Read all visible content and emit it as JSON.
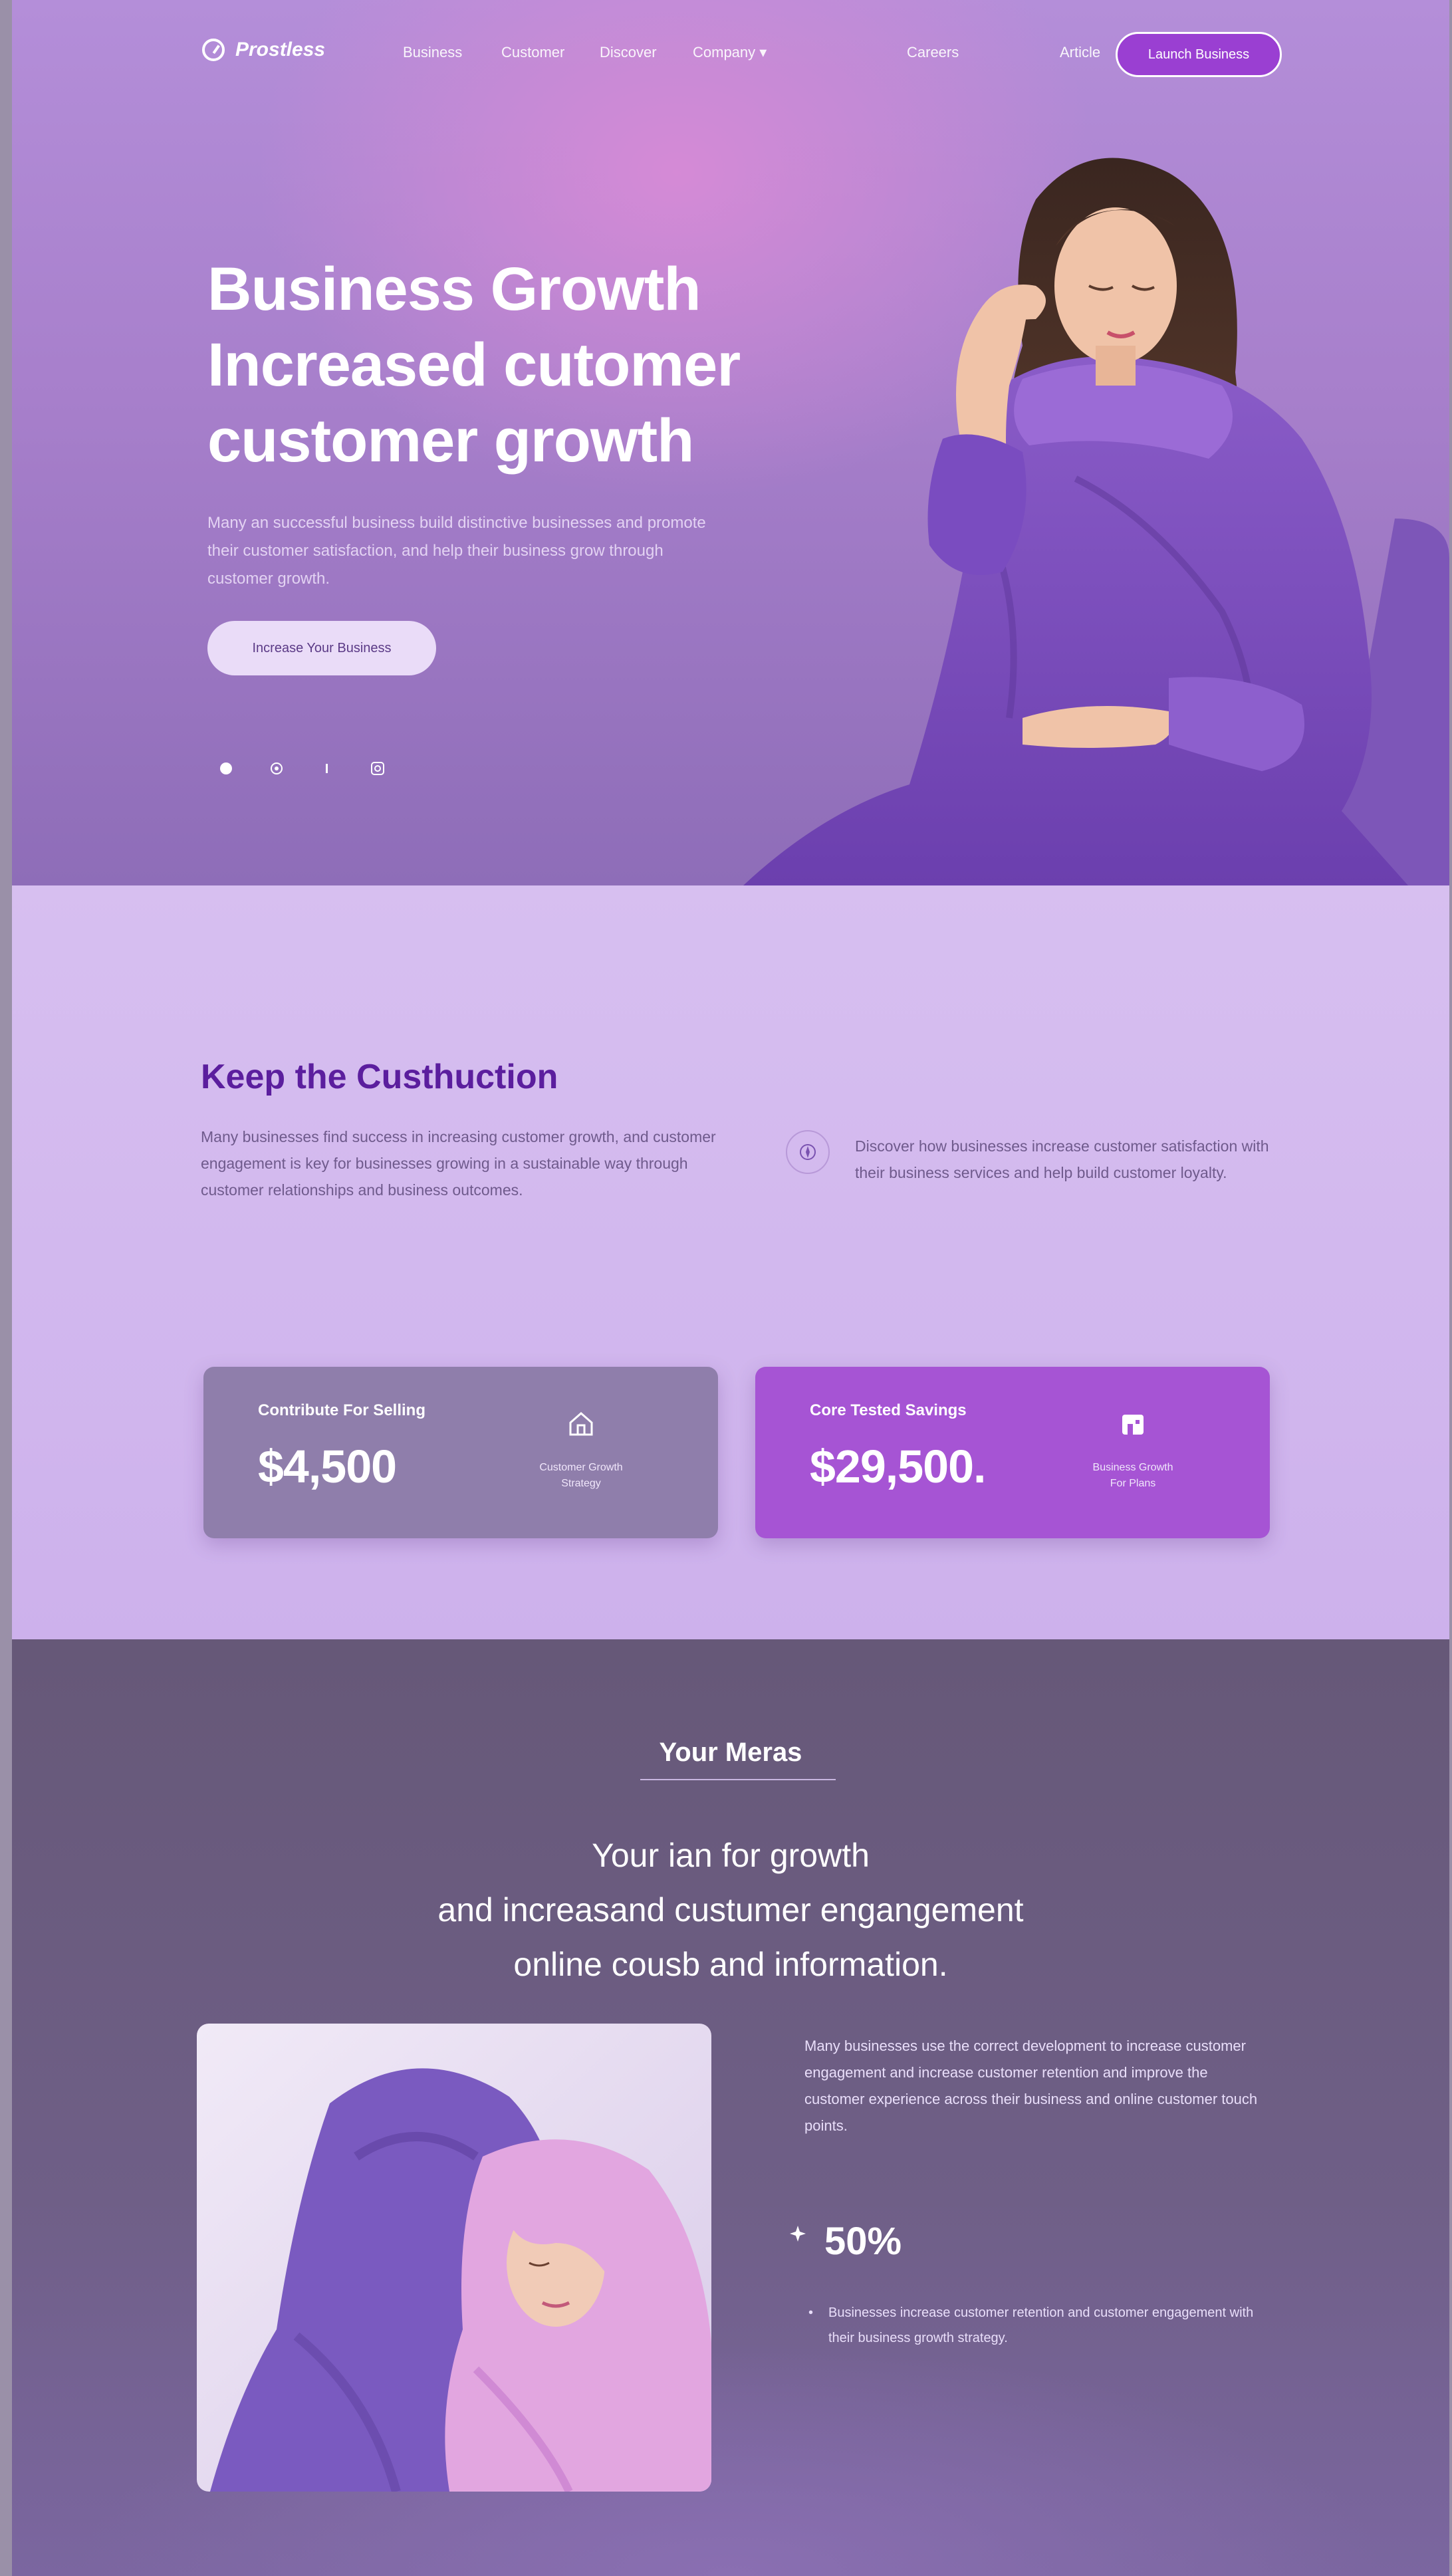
{
  "nav": {
    "brand": "Prostless",
    "links": [
      "Business",
      "Customer",
      "Discover",
      "Company ▾"
    ],
    "right_links": [
      "Careers",
      "Article"
    ],
    "cta": "Launch Business"
  },
  "hero": {
    "title_lines": [
      "Business Growth",
      "Increased cutomer",
      "customer growth"
    ],
    "description": "Many an successful business build distinctive businesses and promote their customer satisfaction, and help their business grow through customer growth.",
    "button": "Increase Your Business"
  },
  "section2": {
    "title": "Keep the Custhuction",
    "description": "Many businesses find success in increasing customer growth, and customer engagement is key for businesses growing in a sustainable way through customer relationships and business outcomes.",
    "info_text": "Discover how businesses increase customer satisfaction with their business services and help build customer loyalty.",
    "cards": [
      {
        "label": "Contribute For Selling",
        "value": "$4,500",
        "sub": "Customer Growth Strategy"
      },
      {
        "label": "Core Tested Savings",
        "value": "$29,500.",
        "sub": "Business Growth For Plans"
      }
    ]
  },
  "section3": {
    "kicker": "Your Meras",
    "heading_lines": [
      "Your ian for growth",
      "and increasand custumer engangement",
      "online cousb and information."
    ],
    "description": "Many businesses use the correct development to increase customer engagement and increase customer retention and improve the customer experience across their business and online customer touch points.",
    "stat_value": "50%",
    "stat_description": "Businesses increase customer retention and customer engagement with their business growth strategy."
  }
}
